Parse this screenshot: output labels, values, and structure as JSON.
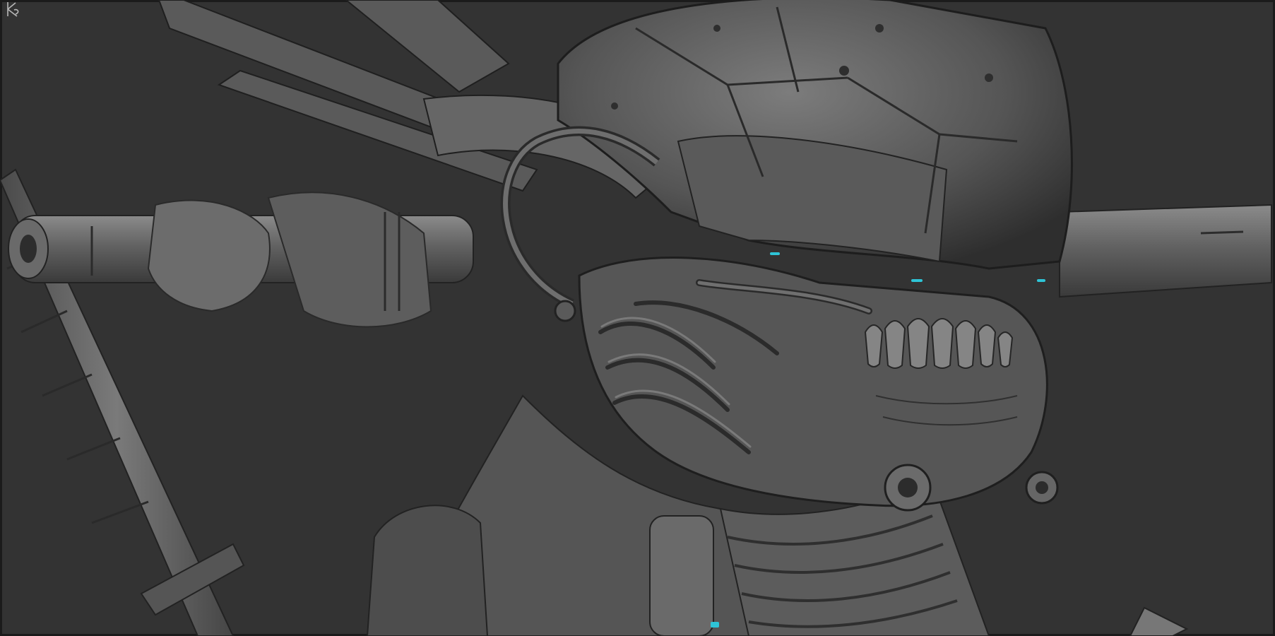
{
  "image": {
    "background_color": "#333333",
    "clay_color": "#5f5f5f",
    "clay_light": "#8a8a8a",
    "clay_dark": "#2a2a2a",
    "accent_color": "#2ec4d6",
    "signature_mark": "KS"
  }
}
